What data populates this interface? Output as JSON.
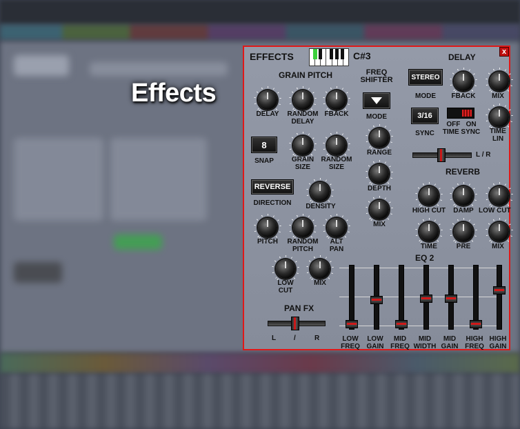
{
  "caption": "Effects",
  "panel": {
    "title": "EFFECTS",
    "note": "C#3",
    "close": "x",
    "grain_pitch": {
      "title": "GRAIN PITCH",
      "knobs": [
        "DELAY",
        "RANDOM\nDELAY",
        "FBACK",
        "GRAIN\nSIZE",
        "RANDOM\nSIZE",
        "DENSITY",
        "PITCH",
        "RANDOM\nPITCH",
        "ALT\nPAN",
        "LOW\nCUT",
        "MIX"
      ],
      "snap_value": "8",
      "snap_label": "SNAP",
      "direction_value": "REVERSE",
      "direction_label": "DIRECTION"
    },
    "freq_shifter": {
      "title": "FREQ\nSHIFTER",
      "mode_label": "MODE",
      "knobs": [
        "RANGE",
        "DEPTH",
        "MIX"
      ]
    },
    "delay": {
      "title": "DELAY",
      "mode_value": "STEREO",
      "mode_label": "MODE",
      "fback": "FBACK",
      "mix": "MIX",
      "sync_value": "3/16",
      "sync_label": "SYNC",
      "toggle_label": "OFF   ON\nTIME SYNC",
      "time_lin": "TIME\nLIN",
      "lr": "L / R"
    },
    "reverb": {
      "title": "REVERB",
      "knobs": [
        "HIGH CUT",
        "DAMP",
        "LOW CUT",
        "TIME",
        "PRE",
        "MIX"
      ]
    },
    "pan_fx": {
      "title": "PAN FX",
      "l": "L",
      "mid": "/",
      "r": "R"
    },
    "eq2": {
      "title": "EQ 2",
      "bands": [
        "LOW\nFREQ",
        "LOW\nGAIN",
        "MID\nFREQ",
        "MID\nWIDTH",
        "MID\nGAIN",
        "HIGH\nFREQ",
        "HIGH\nGAIN"
      ],
      "levels": [
        0.03,
        0.45,
        0.03,
        0.48,
        0.47,
        0.03,
        0.62
      ]
    }
  }
}
